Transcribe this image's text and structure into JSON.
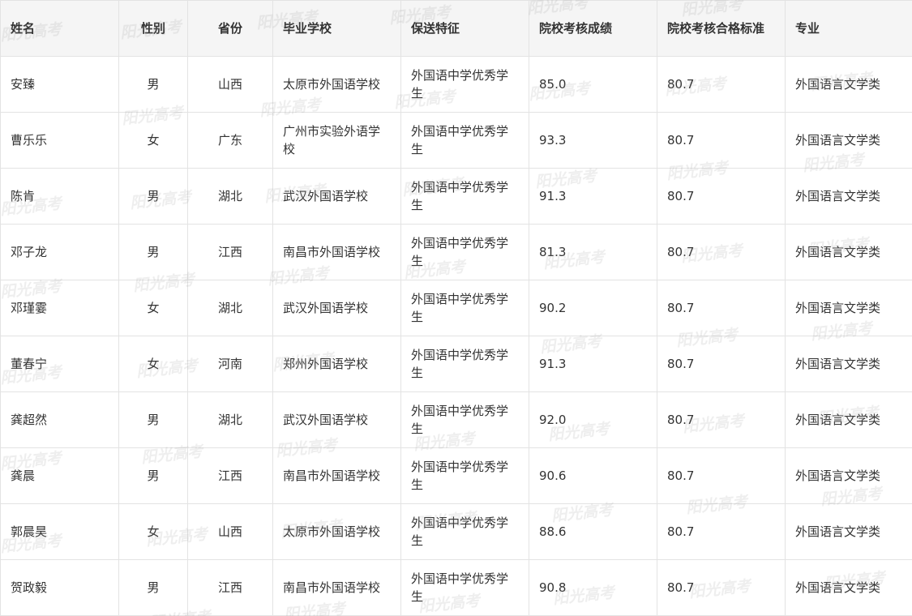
{
  "table": {
    "headers": [
      "姓名",
      "性别",
      "省份",
      "毕业学校",
      "保送特征",
      "院校考核成绩",
      "院校考核合格标准",
      "专业"
    ],
    "rows": [
      [
        "安臻",
        "男",
        "山西",
        "太原市外国语学校",
        "外国语中学优秀学生",
        "85.0",
        "80.7",
        "外国语言文学类"
      ],
      [
        "曹乐乐",
        "女",
        "广东",
        "广州市实验外语学校",
        "外国语中学优秀学生",
        "93.3",
        "80.7",
        "外国语言文学类"
      ],
      [
        "陈肯",
        "男",
        "湖北",
        "武汉外国语学校",
        "外国语中学优秀学生",
        "91.3",
        "80.7",
        "外国语言文学类"
      ],
      [
        "邓子龙",
        "男",
        "江西",
        "南昌市外国语学校",
        "外国语中学优秀学生",
        "81.3",
        "80.7",
        "外国语言文学类"
      ],
      [
        "邓瑾霎",
        "女",
        "湖北",
        "武汉外国语学校",
        "外国语中学优秀学生",
        "90.2",
        "80.7",
        "外国语言文学类"
      ],
      [
        "董春宁",
        "女",
        "河南",
        "郑州外国语学校",
        "外国语中学优秀学生",
        "91.3",
        "80.7",
        "外国语言文学类"
      ],
      [
        "龚超然",
        "男",
        "湖北",
        "武汉外国语学校",
        "外国语中学优秀学生",
        "92.0",
        "80.7",
        "外国语言文学类"
      ],
      [
        "龚晨",
        "男",
        "江西",
        "南昌市外国语学校",
        "外国语中学优秀学生",
        "90.6",
        "80.7",
        "外国语言文学类"
      ],
      [
        "郭晨昊",
        "女",
        "山西",
        "太原市外国语学校",
        "外国语中学优秀学生",
        "88.6",
        "80.7",
        "外国语言文学类"
      ],
      [
        "贺政毅",
        "男",
        "江西",
        "南昌市外国语学校",
        "外国语中学优秀学生",
        "90.8",
        "80.7",
        "外国语言文学类"
      ]
    ]
  },
  "watermark": {
    "text": "阳光高考",
    "color": "#969696"
  },
  "colors": {
    "header_bg": "#f5f5f5",
    "border": "#e3e3e3",
    "text": "#333333"
  }
}
